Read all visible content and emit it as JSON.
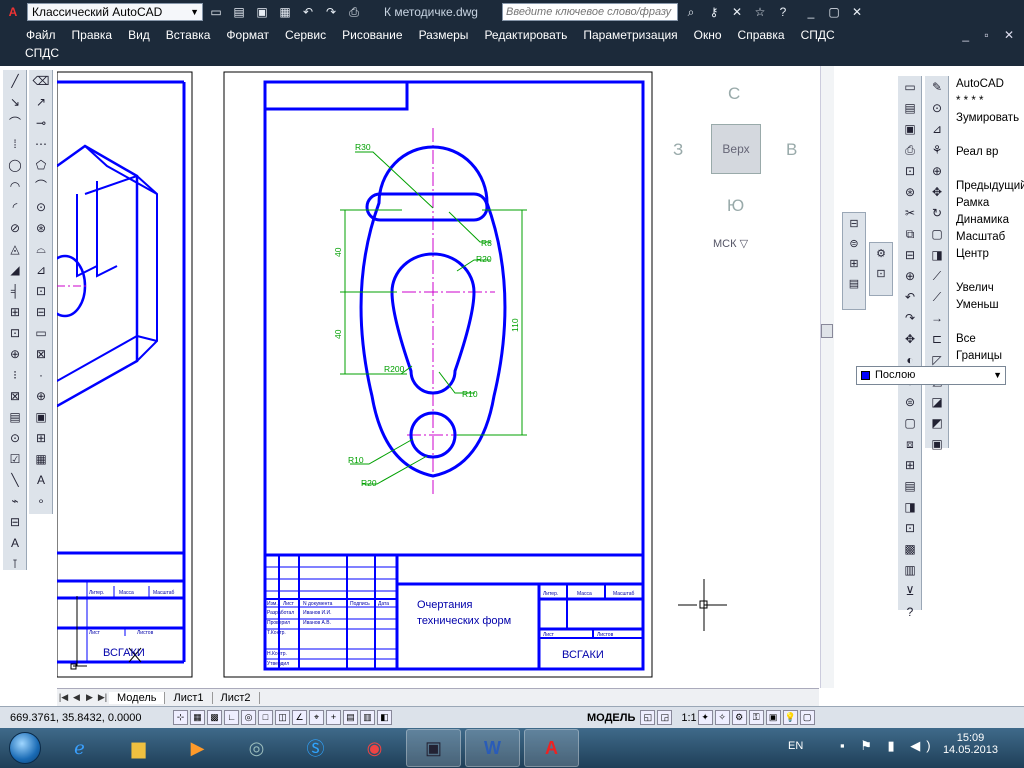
{
  "titlebar": {
    "workspace": "Классический AutoCAD",
    "document": "К методичке.dwg",
    "search_placeholder": "Введите ключевое слово/фразу",
    "help": "?"
  },
  "menu": {
    "items": [
      "Файл",
      "Правка",
      "Вид",
      "Вставка",
      "Формат",
      "Сервис",
      "Рисование",
      "Размеры",
      "Редактировать",
      "Параметризация",
      "Окно",
      "Справка",
      "СПДС"
    ],
    "row2": "СПДС"
  },
  "viewcube": {
    "north": "С",
    "south": "Ю",
    "west": "З",
    "east": "В",
    "top": "Верх",
    "ucs": "МСК"
  },
  "zoom_panel": {
    "items": [
      "AutoCAD",
      "* * * *",
      "Зумировать",
      "",
      "Реал вр",
      "",
      "Предыдущий",
      "Рамка",
      "Динамика",
      "Масштаб",
      "Центр",
      "",
      "Увелич",
      "Уменьш",
      "",
      "Все",
      "Границы"
    ]
  },
  "layer": {
    "name": "Послою"
  },
  "drawing": {
    "dims": {
      "r30": "R30",
      "r8": "R8",
      "r20a": "R20",
      "r200": "R200",
      "r10a": "R10",
      "r10b": "R10",
      "r20b": "R20",
      "d40a": "40",
      "d40b": "40",
      "d110": "110"
    },
    "title_block": {
      "name_line1": "Очертания",
      "name_line2": "технических форм",
      "org": "ВСГАКИ",
      "org_left": "ВСГАКИ",
      "stage": "Литер.",
      "mass": "Масса",
      "scale": "Масштаб",
      "sheet": "Лист",
      "sheets": "Листов",
      "rows": [
        "Изм.",
        "Лист",
        "N документа",
        "Подпись",
        "Дата"
      ],
      "developed": "Разработал",
      "checked": "Проверил",
      "tech": "Т.Контр.",
      "ncontr": "Н.Контр.",
      "approved": "Утвердил",
      "dev_name": "Иванов И.И.",
      "chk_name": "Иванов А.В."
    }
  },
  "tabs": [
    "Модель",
    "Лист1",
    "Лист2"
  ],
  "status": {
    "coords": "669.3761, 35.8432, 0.0000",
    "model": "МОДЕЛЬ",
    "scale": "1:1"
  },
  "tray": {
    "lang": "EN",
    "time": "15:09",
    "date": "14.05.2013"
  }
}
